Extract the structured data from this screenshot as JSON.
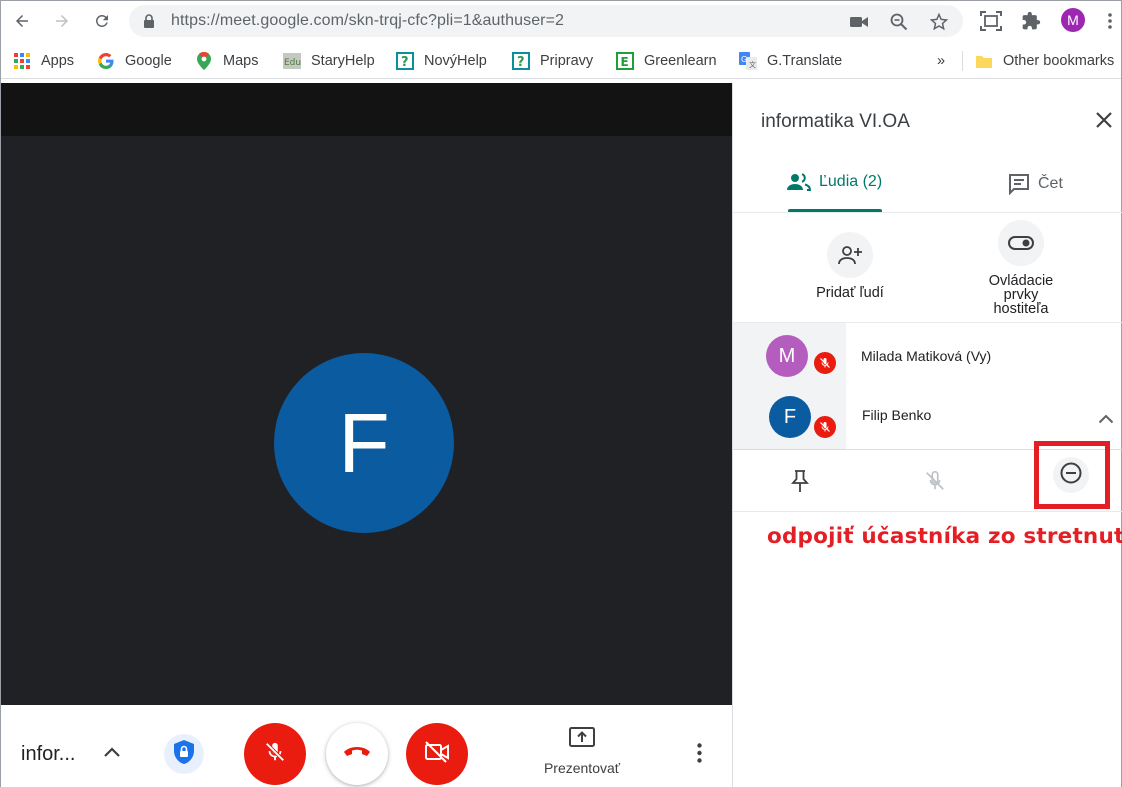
{
  "browser": {
    "url": "https://meet.google.com/skn-trqj-cfc?pli=1&authuser=2",
    "profile_initial": "M",
    "bookmarks": [
      {
        "label": "Apps",
        "icon": "apps-grid-icon"
      },
      {
        "label": "Google",
        "icon": "google-g-icon"
      },
      {
        "label": "Maps",
        "icon": "maps-pin-icon"
      },
      {
        "label": "StaryHelp",
        "icon": "edu-icon"
      },
      {
        "label": "NovýHelp",
        "icon": "help-question-icon"
      },
      {
        "label": "Pripravy",
        "icon": "help-question-icon"
      },
      {
        "label": "Greenlearn",
        "icon": "greenlearn-e-icon"
      },
      {
        "label": "G.Translate",
        "icon": "translate-icon"
      }
    ],
    "more_bookmarks": "»",
    "other_bookmarks": "Other bookmarks"
  },
  "stage": {
    "avatar_initial": "F",
    "avatar_color": "#0b5ba1"
  },
  "bottom_bar": {
    "meeting_name": "infor...",
    "present_label": "Prezentovať"
  },
  "panel": {
    "title": "informatika VI.OA",
    "tabs": {
      "people": "Ľudia (2)",
      "chat": "Čet"
    },
    "actions": {
      "add_people": "Pridať ľudí",
      "host_controls_line1": "Ovládacie",
      "host_controls_line2": "prvky",
      "host_controls_line3": "hostiteľa"
    },
    "participants": [
      {
        "initial": "M",
        "name": "Milada Matiková (Vy)",
        "color": "#b55dbf"
      },
      {
        "initial": "F",
        "name": "Filip Benko",
        "color": "#0b5ba1"
      }
    ],
    "annotation": "odpojiť účastníka zo stretnutia"
  },
  "colors": {
    "accent": "#00796b",
    "danger": "#ea1c0f",
    "annotation": "#e31e24"
  }
}
